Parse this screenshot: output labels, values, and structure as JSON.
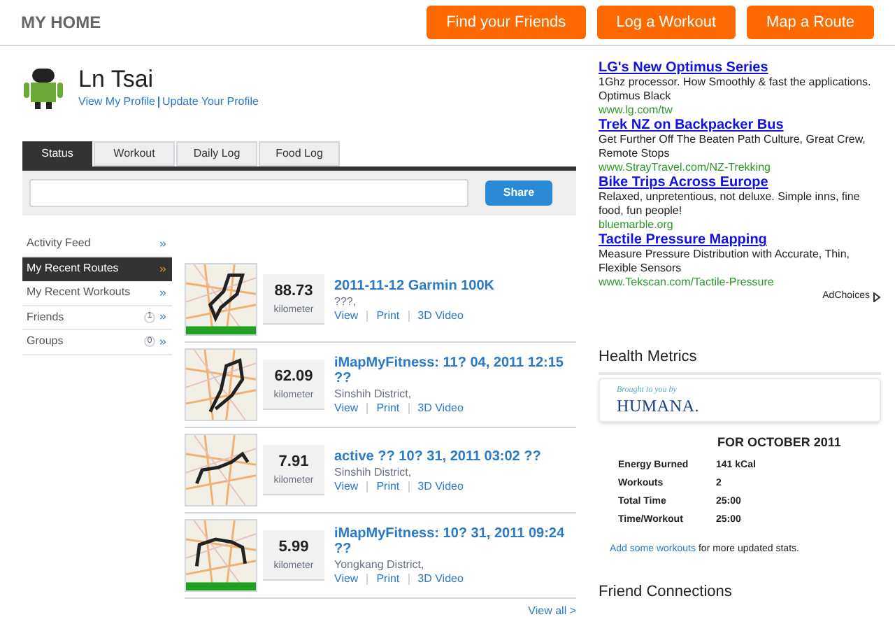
{
  "header": {
    "title": "MY HOME",
    "buttons": [
      "Find your Friends",
      "Log a Workout",
      "Map a Route"
    ]
  },
  "profile": {
    "name": "Ln Tsai",
    "links": [
      "View My Profile",
      "Update Your Profile"
    ]
  },
  "tabs": [
    {
      "label": "Status",
      "selected": true
    },
    {
      "label": "Workout",
      "selected": false
    },
    {
      "label": "Daily Log",
      "selected": false
    },
    {
      "label": "Food Log",
      "selected": false
    }
  ],
  "status": {
    "button": "Share"
  },
  "sidebar": {
    "items": [
      {
        "label": "Activity Feed",
        "selected": false
      },
      {
        "label": "My Recent Routes",
        "selected": true
      },
      {
        "label": "My Recent Workouts",
        "selected": false
      },
      {
        "label": "Friends",
        "count": "1",
        "selected": false
      },
      {
        "label": "Groups",
        "count": "0",
        "selected": false
      }
    ]
  },
  "routes": {
    "rows": [
      {
        "distance": "88.73",
        "unit": "kilometer",
        "title": "2011-11-12 Garmin 100K",
        "location": "???,",
        "actions": [
          "View",
          "Print",
          "3D Video"
        ]
      },
      {
        "distance": "62.09",
        "unit": "kilometer",
        "title": "iMapMyFitness: 11? 04, 2011 12:15 ??",
        "location": "Sinshih District,",
        "actions": [
          "View",
          "Print",
          "3D Video"
        ]
      },
      {
        "distance": "7.91",
        "unit": "kilometer",
        "title": "active ?? 10? 31, 2011 03:02 ??",
        "location": "Sinshih District,",
        "actions": [
          "View",
          "Print",
          "3D Video"
        ]
      },
      {
        "distance": "5.99",
        "unit": "kilometer",
        "title": "iMapMyFitness: 10? 31, 2011 09:24 ??",
        "location": "Yongkang District,",
        "actions": [
          "View",
          "Print",
          "3D Video"
        ]
      }
    ],
    "view_all": "View all >"
  },
  "ads": {
    "items": [
      {
        "title": "LG's New Optimus Series",
        "text": "1Ghz processor. How Smoothly & fast the applications. Optimus Black",
        "url": "www.lg.com/tw"
      },
      {
        "title": "Trek NZ on Backpacker Bus",
        "text": "Get Further Off The Beaten Path Culture, Great Crew, Remote Stops",
        "url": "www.StrayTravel.com/NZ-Trekking"
      },
      {
        "title": "Bike Trips Across Europe",
        "text": "Relaxed, unpretentious, not deluxe. Simple inns, fine food, fun people!",
        "url": "bluemarble.org"
      },
      {
        "title": "Tactile Pressure Mapping",
        "text": "Measure Pressure Distribution with Accurate, Thin, Flexible Sensors",
        "url": "www.Tekscan.com/Tactile-Pressure"
      }
    ],
    "adchoices": "AdChoices"
  },
  "health": {
    "title": "Health Metrics",
    "sponsor_line": "Brought to you by",
    "sponsor": "HUMANA.",
    "period": "FOR OCTOBER 2011",
    "stats": [
      {
        "label": "Energy Burned",
        "value": "141 kCal"
      },
      {
        "label": "Workouts",
        "value": "2"
      },
      {
        "label": "Total Time",
        "value": "25:00"
      },
      {
        "label": "Time/Workout",
        "value": "25:00"
      }
    ],
    "footer_link": "Add some workouts",
    "footer_text": "for more updated stats."
  },
  "next_section": {
    "title": "Friend Connections"
  }
}
